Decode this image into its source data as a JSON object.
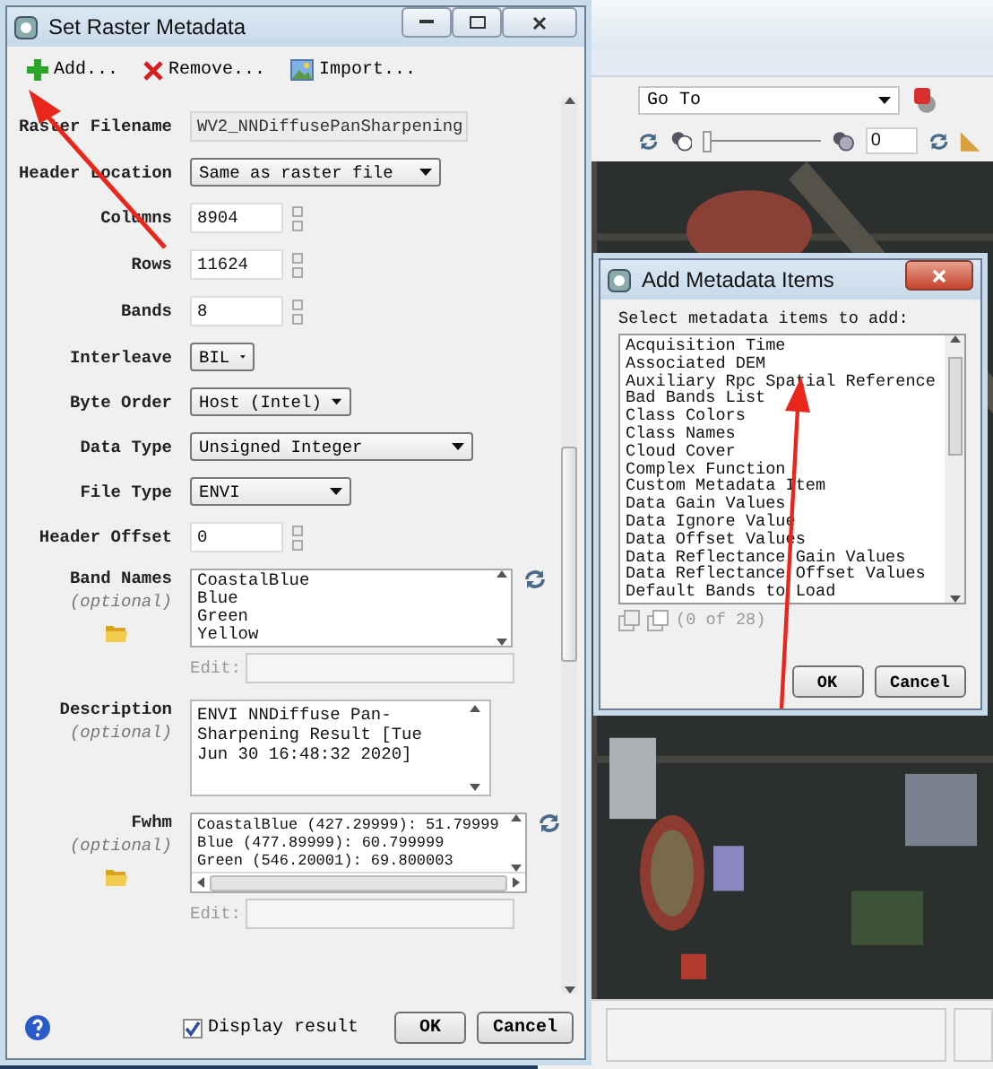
{
  "viewer": {
    "goto": {
      "value": "Go To"
    },
    "stretch_slider": {
      "level": 0
    },
    "stretch_value": "0"
  },
  "set_raster_metadata": {
    "title": "Set Raster Metadata",
    "toolbar": [
      {
        "kind": "add",
        "label": "Add..."
      },
      {
        "kind": "remove",
        "label": "Remove..."
      },
      {
        "kind": "import",
        "label": "Import..."
      }
    ],
    "fields": [
      {
        "kind": "readonly",
        "label": "Raster Filename",
        "value": "WV2_NNDiffusePanSharpening"
      },
      {
        "kind": "dropdown",
        "label": "Header Location",
        "value": "Same as raster file"
      },
      {
        "kind": "spinner",
        "label": "Columns",
        "value": "8904"
      },
      {
        "kind": "spinner",
        "label": "Rows",
        "value": "11624"
      },
      {
        "kind": "spinner",
        "label": "Bands",
        "value": "8"
      },
      {
        "kind": "dropdown",
        "label": "Interleave",
        "value": "BIL"
      },
      {
        "kind": "dropdown",
        "label": "Byte Order",
        "value": "Host (Intel)"
      },
      {
        "kind": "dropdown",
        "label": "Data Type",
        "value": "Unsigned Integer"
      },
      {
        "kind": "dropdown",
        "label": "File Type",
        "value": "ENVI"
      },
      {
        "kind": "spinner",
        "label": "Header Offset",
        "value": "0"
      },
      {
        "kind": "list",
        "label": "Band Names",
        "optional": "(optional)",
        "lines": [
          "CoastalBlue",
          "Blue",
          "Green",
          "Yellow"
        ],
        "edit_label": "Edit:"
      },
      {
        "kind": "textarea",
        "label": "Description",
        "optional": "(optional)",
        "value": "ENVI NNDiffuse Pan-Sharpening Result [Tue Jun 30 16:48:32 2020]"
      },
      {
        "kind": "list",
        "label": "Fwhm",
        "optional": "(optional)",
        "lines": [
          "CoastalBlue (427.29999): 51.79999",
          "Blue (477.89999): 60.799999",
          "Green (546.20001): 69.800003"
        ],
        "edit_label": "Edit:",
        "hscroll": true
      }
    ],
    "display_result": {
      "label": "Display result",
      "checked": true
    },
    "buttons": [
      "OK",
      "Cancel"
    ]
  },
  "add_metadata_items": {
    "title": "Add Metadata Items",
    "prompt": "Select metadata items to add:",
    "items": [
      {
        "label": "Acquisition Time",
        "selected": false
      },
      {
        "label": "Associated DEM",
        "selected": false
      },
      {
        "label": "Auxiliary Rpc Spatial Reference",
        "selected": false
      },
      {
        "label": "Bad Bands List",
        "selected": false
      },
      {
        "label": "Class Colors",
        "selected": false
      },
      {
        "label": "Class Names",
        "selected": false
      },
      {
        "label": "Cloud Cover",
        "selected": false
      },
      {
        "label": "Complex Function",
        "selected": false
      },
      {
        "label": "Custom Metadata Item",
        "selected": false
      },
      {
        "label": "Data Gain Values",
        "selected": false
      },
      {
        "label": "Data Ignore Value",
        "selected": false
      },
      {
        "label": "Data Offset Values",
        "selected": false
      },
      {
        "label": "Data Reflectance Gain Values",
        "selected": false
      },
      {
        "label": "Data Reflectance Offset Values",
        "selected": false
      },
      {
        "label": "Default Bands to Load",
        "selected": false
      }
    ],
    "count": "(0 of 28)",
    "buttons": [
      "OK",
      "Cancel"
    ]
  }
}
